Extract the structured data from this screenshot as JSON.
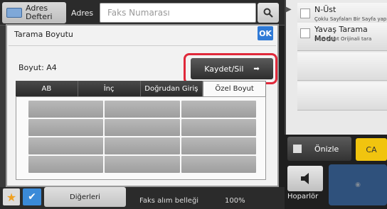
{
  "header": {
    "address_book_label": "Adres Defteri",
    "address_label": "Adres",
    "fax_number_placeholder": "Faks Numarası"
  },
  "right_panel": {
    "options": [
      {
        "title": "N-Üst",
        "subtitle": "Çoklu Sayfaları Bir Sayfa yap"
      },
      {
        "title": "Yavaş Tarama Modu",
        "subtitle": "İnce Kağıt Orijinali tara"
      }
    ]
  },
  "dialog": {
    "title": "Tarama Boyutu",
    "ok_label": "OK",
    "size_label": "Boyut: A4",
    "save_delete_label": "Kaydet/Sil",
    "tabs": [
      {
        "label": "AB",
        "active": false
      },
      {
        "label": "İnç",
        "active": false
      },
      {
        "label": "Doğrudan Giriş",
        "active": false
      },
      {
        "label": "Özel Boyut",
        "active": true
      }
    ]
  },
  "bottom": {
    "others_label": "Diğerleri",
    "fax_memory_label": "Faks alım belleği",
    "fax_memory_value": "100%"
  },
  "actions": {
    "preview_label": "Önizle",
    "ca_label": "CA",
    "speaker_label": "Hoparlör"
  },
  "colors": {
    "accent_blue": "#2f7ad6",
    "highlight_red": "#e0283a",
    "ca_yellow": "#f1c40f"
  }
}
